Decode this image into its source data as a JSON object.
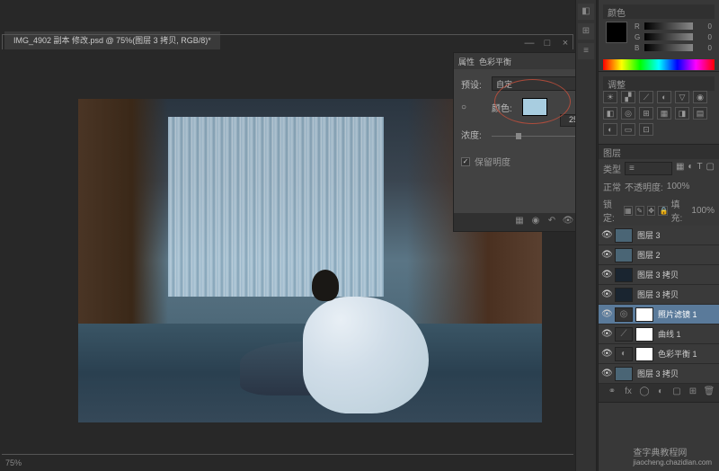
{
  "document": {
    "tab_title": "IMG_4902 副本 修改.psd @ 75%(图层 3 拷贝, RGB/8)*"
  },
  "dialog": {
    "tab1": "属性",
    "tab2": "色彩平衡",
    "preset_label": "预设:",
    "preset_value": "自定",
    "color_label": "颜色:",
    "density_label": "浓度:",
    "density_value": "25",
    "preserve_label": "保留明度"
  },
  "color_panel": {
    "title": "颜色",
    "r_label": "R",
    "r_val": "0",
    "g_label": "G",
    "g_val": "0",
    "b_label": "B",
    "b_val": "0"
  },
  "adjustments": {
    "title": "调整"
  },
  "layers": {
    "title": "图层",
    "kind_label": "类型",
    "blend_mode": "正常",
    "opacity_label": "不透明度:",
    "opacity_value": "100%",
    "lock_label": "锁定:",
    "fill_label": "填充:",
    "fill_value": "100%",
    "items": [
      {
        "name": "图层 3",
        "type": "normal"
      },
      {
        "name": "图层 2",
        "type": "normal"
      },
      {
        "name": "图层 3 拷贝",
        "type": "normal"
      },
      {
        "name": "图层 3 拷贝",
        "type": "normal"
      },
      {
        "name": "照片滤镜 1",
        "type": "adjust",
        "active": true
      },
      {
        "name": "曲线 1",
        "type": "adjust"
      },
      {
        "name": "色彩平衡 1",
        "type": "adjust"
      },
      {
        "name": "图层 3 拷贝",
        "type": "normal"
      }
    ]
  },
  "watermark": {
    "text": "查字典教程网",
    "url": "jiaocheng.chazidian.com"
  },
  "status": {
    "text": "75%"
  }
}
